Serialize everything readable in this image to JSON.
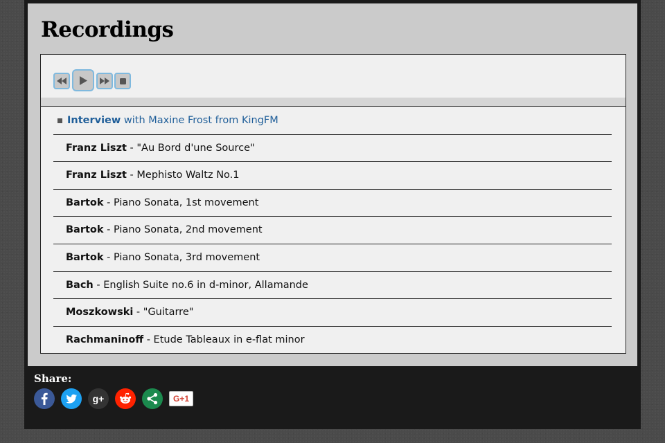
{
  "page": {
    "title": "Recordings"
  },
  "player": {
    "controls": [
      {
        "name": "rewind",
        "icon": "rewind-icon"
      },
      {
        "name": "play",
        "icon": "play-icon"
      },
      {
        "name": "fast-forward",
        "icon": "fast-forward-icon"
      },
      {
        "name": "stop",
        "icon": "stop-icon"
      }
    ]
  },
  "playlist": [
    {
      "artist": "Interview",
      "title": " with Maxine Frost from KingFM",
      "active": true
    },
    {
      "artist": "Franz Liszt",
      "title": " - \"Au Bord d'une Source\""
    },
    {
      "artist": "Franz Liszt",
      "title": " - Mephisto Waltz No.1"
    },
    {
      "artist": "Bartok",
      "title": " - Piano Sonata, 1st movement"
    },
    {
      "artist": "Bartok",
      "title": " - Piano Sonata, 2nd movement"
    },
    {
      "artist": "Bartok",
      "title": " - Piano Sonata, 3rd movement"
    },
    {
      "artist": "Bach",
      "title": " - English Suite no.6 in d-minor, Allamande"
    },
    {
      "artist": "Moszkowski",
      "title": " - \"Guitarre\""
    },
    {
      "artist": "Rachmaninoff",
      "title": " - Etude Tableaux in e-flat minor"
    }
  ],
  "share": {
    "label": "Share:",
    "buttons": [
      {
        "name": "facebook",
        "icon": "facebook-icon",
        "glyph": "f",
        "color": "#3b5998"
      },
      {
        "name": "twitter",
        "icon": "twitter-icon",
        "glyph": "t",
        "color": "#1da1f2"
      },
      {
        "name": "google-plus",
        "icon": "google-plus-icon",
        "glyph": "g+",
        "color": "#333333"
      },
      {
        "name": "reddit",
        "icon": "reddit-icon",
        "glyph": "r",
        "color": "#ff2200"
      },
      {
        "name": "share",
        "icon": "share-icon",
        "glyph": "<",
        "color": "#1b8a4e"
      }
    ],
    "plus_one": "G+1"
  },
  "colors": {
    "active_track": "#1f5e99",
    "control_border": "#7fb9de"
  }
}
